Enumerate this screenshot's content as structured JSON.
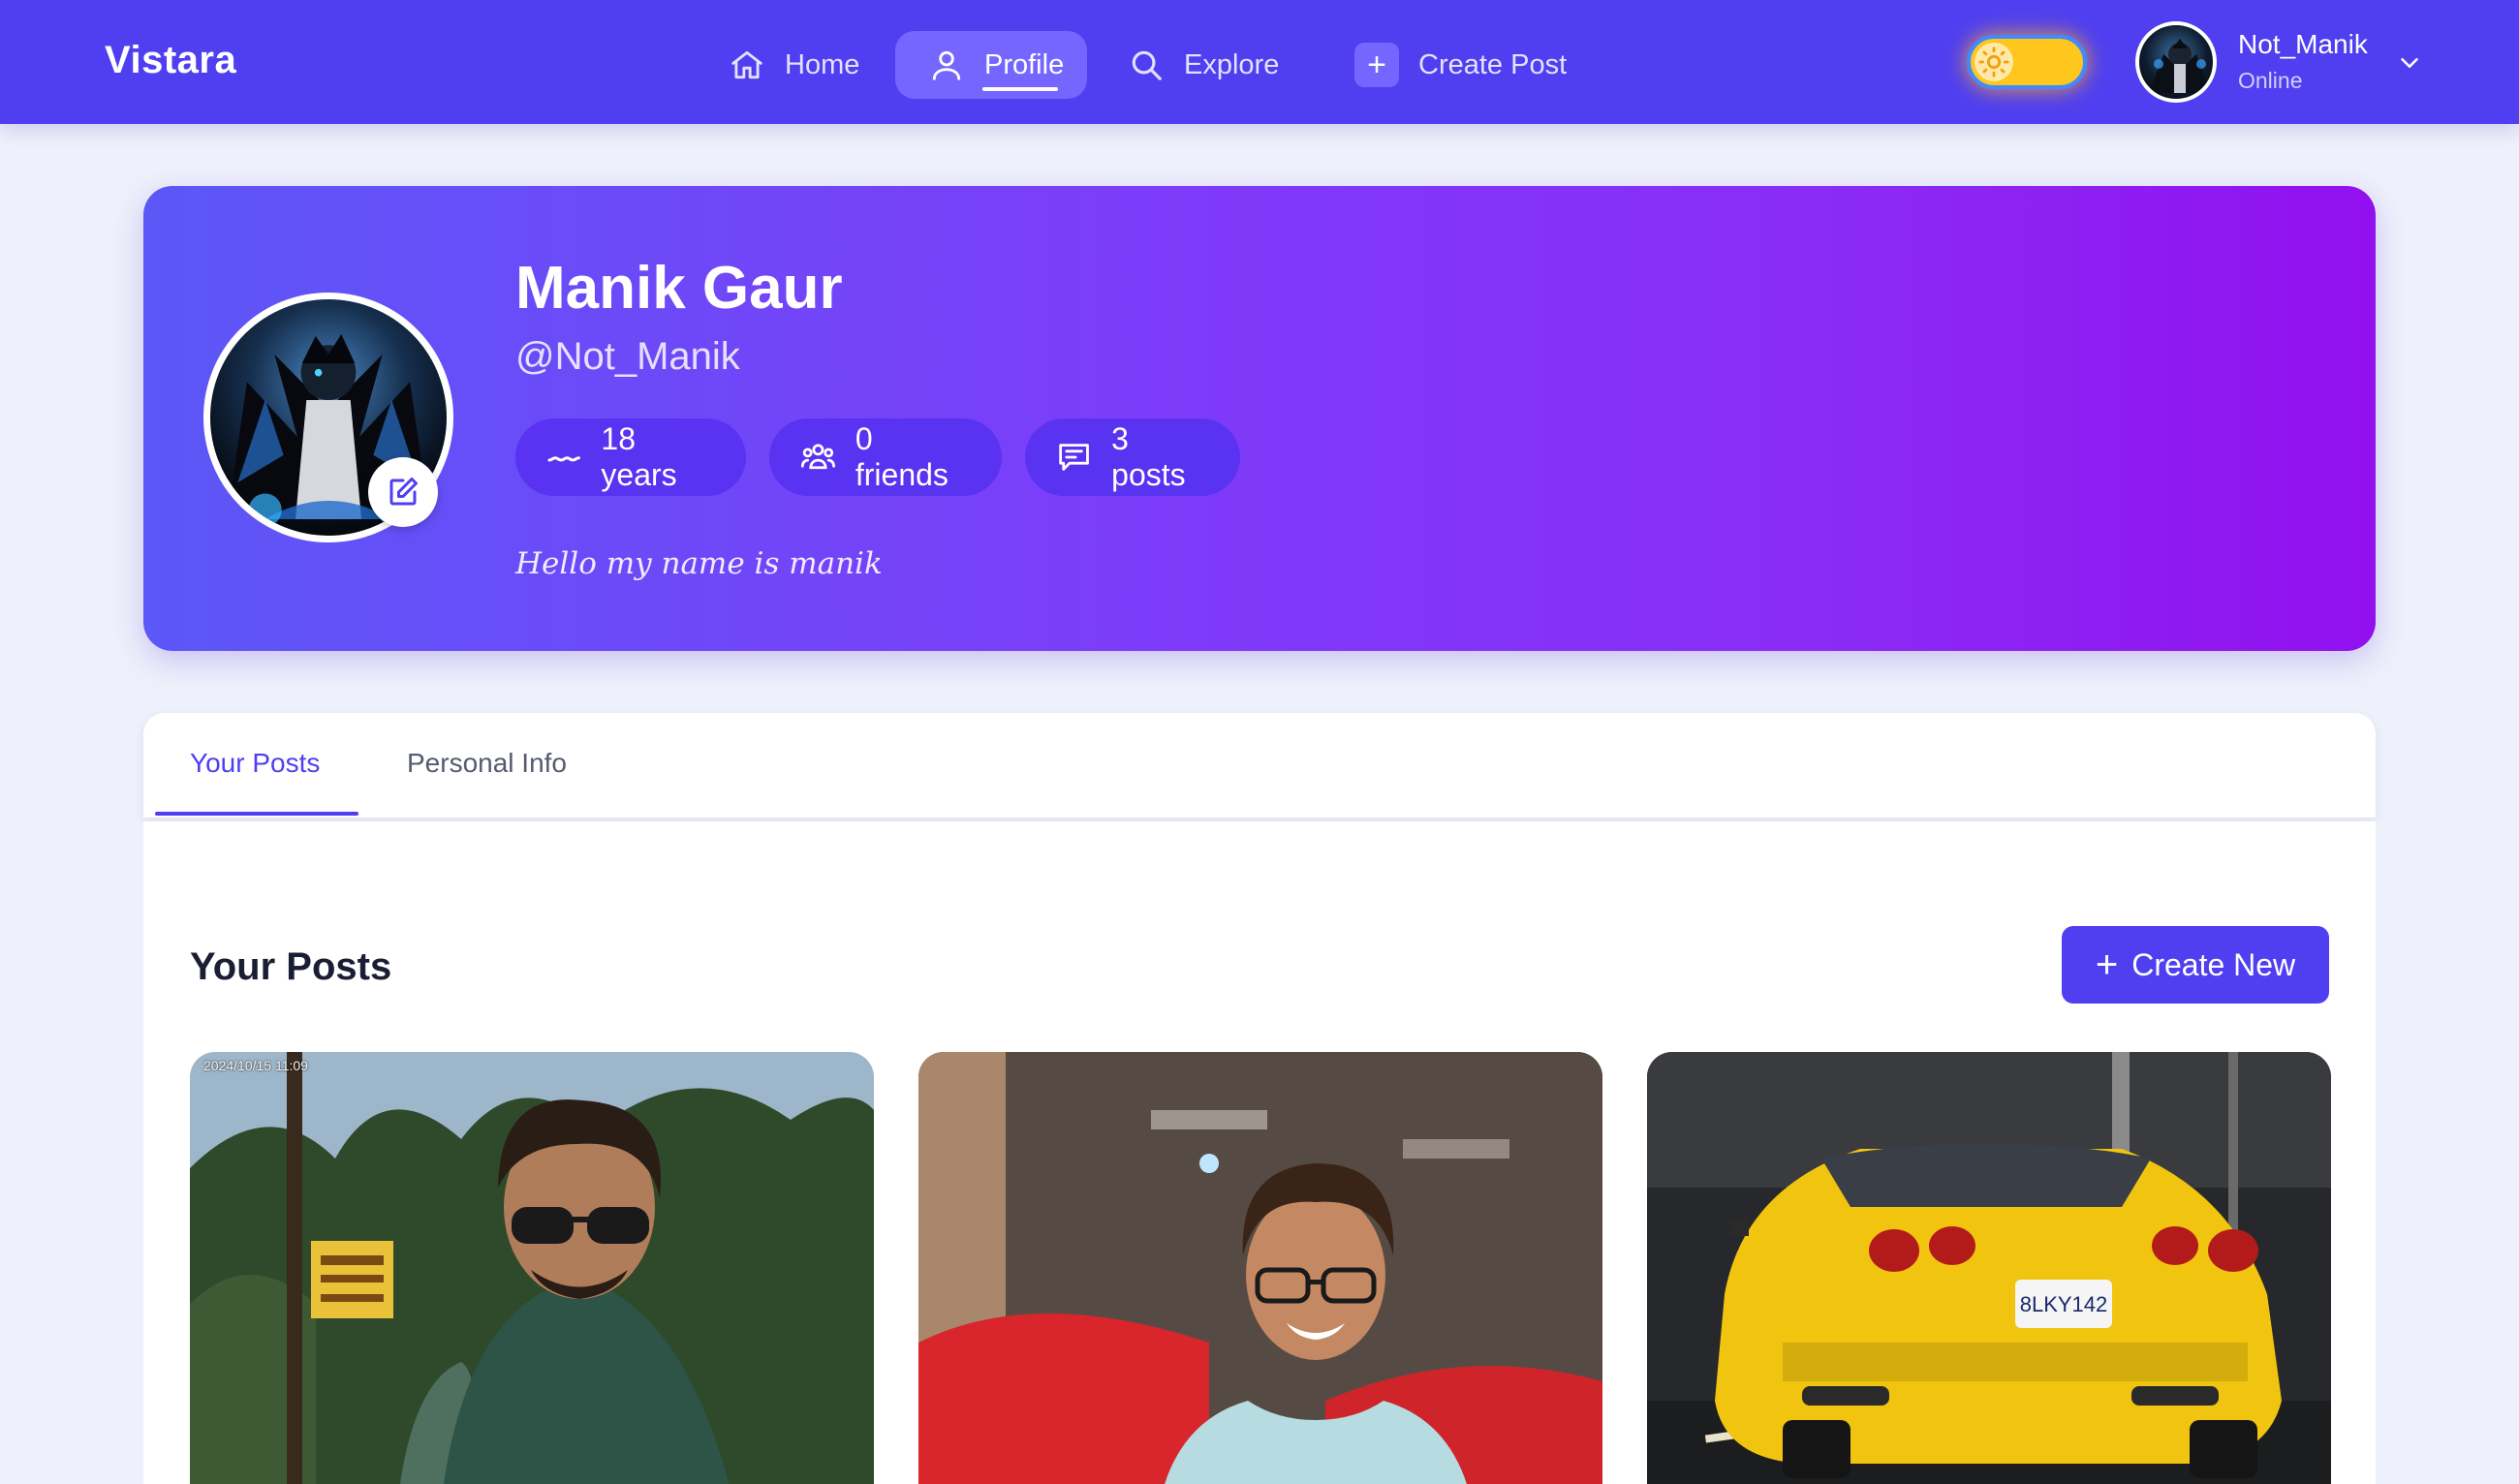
{
  "nav": {
    "brand": "Vistara",
    "items": [
      {
        "label": "Home",
        "icon": "home-icon"
      },
      {
        "label": "Profile",
        "icon": "user-icon",
        "active": true
      },
      {
        "label": "Explore",
        "icon": "search-icon"
      },
      {
        "label": "Create Post",
        "icon": "plus-icon"
      }
    ],
    "theme_toggle": {
      "mode": "light",
      "icon": "sun-icon"
    },
    "user": {
      "name": "Not_Manik",
      "status": "Online"
    }
  },
  "profile": {
    "name": "Manik Gaur",
    "handle": "@Not_Manik",
    "stats": {
      "age": "18 years",
      "friends": "0 friends",
      "posts": "3 posts"
    },
    "bio": "Hello my name is manik"
  },
  "tabs": [
    {
      "label": "Your Posts",
      "active": true
    },
    {
      "label": "Personal Info",
      "active": false
    }
  ],
  "posts_section": {
    "title": "Your Posts",
    "create_button": "Create New",
    "posts": [
      {
        "image": "selfie outdoors with trees",
        "stamp": "2024/10/15 11:09"
      },
      {
        "image": "smiling person on red sofa"
      },
      {
        "image": "yellow sports car rear view",
        "plate": "8LKY142"
      }
    ]
  },
  "colors": {
    "primary": "#4f3ff0",
    "hero_start": "#5c57f7",
    "hero_end": "#9210ef",
    "page_bg": "#eef0fb"
  }
}
